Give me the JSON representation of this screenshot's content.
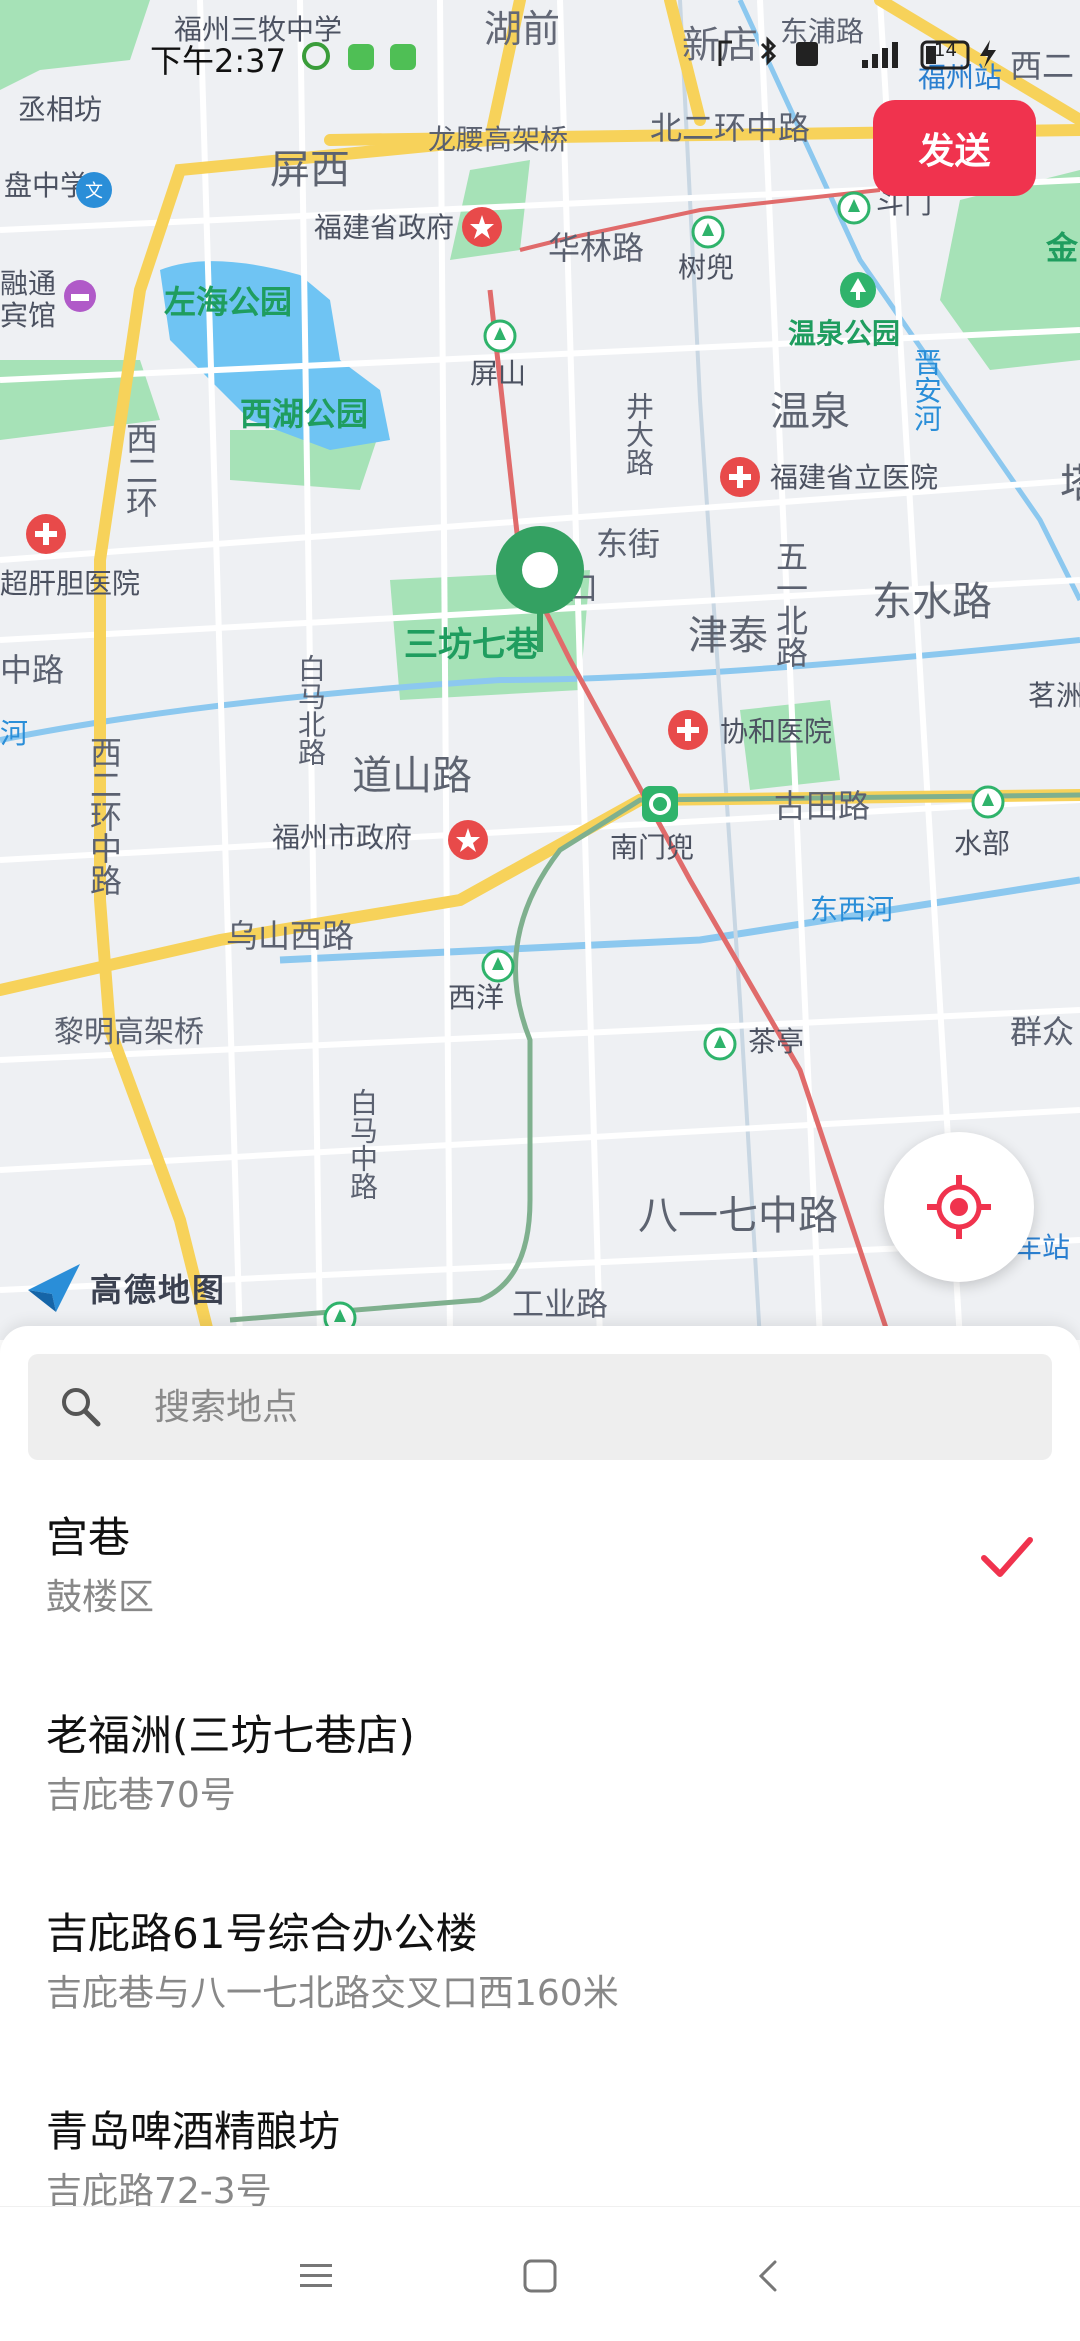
{
  "status_bar": {
    "time": "下午2:37",
    "battery": "14"
  },
  "toolbar": {
    "send_label": "发送"
  },
  "map": {
    "provider_logo_text": "高德地图",
    "pin_icon": "location-pin-icon",
    "locate_icon": "locate-target-icon",
    "labels": {
      "school": "福州三牧中学",
      "hupian": "湖前",
      "xindian": "新店",
      "dongpu_road": "东浦路",
      "fuzhou_station": "福州站",
      "xi_er": "西二",
      "chengxiangfang": "丞相坊",
      "pingxi": "屏西",
      "longteng": "龙腰高架桥",
      "beierhuan": "北二环中路",
      "doumen": "斗门",
      "jin": "金",
      "pan_school": "盘中学",
      "gov": "福建省政府",
      "hualin": "华林路",
      "shudou": "树兜",
      "rongtong": "融通",
      "hotel": "宾馆",
      "zuohai": "左海公园",
      "wenquan_park": "温泉公园",
      "pingshan": "屏山",
      "jinan_river": "晋安河",
      "wenquan": "温泉",
      "xihu": "西湖公园",
      "jingda": "井大路",
      "provincial_hosp": "福建省立医院",
      "ta": "塔",
      "xierhuan": "西二环",
      "liver_hosp": "超肝胆医院",
      "dongjie": "东街",
      "kou": "口",
      "wuyi": "五一北路",
      "dongshui": "东水路",
      "zhonglu": "中路",
      "sanfang": "三坊七巷",
      "jintai": "津泰",
      "mingzhu": "茗洲",
      "he": "河",
      "baima_n": "白马北路",
      "xiehe": "协和医院",
      "daoshan": "道山路",
      "xierhuan_z": "西二环中路",
      "city_gov": "福州市政府",
      "nanmen": "南门兜",
      "gutian": "古田路",
      "shuibu": "水部",
      "wushan": "乌山西路",
      "dongxi_river": "东西河",
      "xiyang": "西洋",
      "liming": "黎明高架桥",
      "chating": "茶亭",
      "qunzhong": "群众",
      "baima_z": "白马中路",
      "bayiqi": "八一七中路",
      "che_station": "车站",
      "gongye": "工业路"
    }
  },
  "search": {
    "placeholder": "搜索地点",
    "value": ""
  },
  "results": [
    {
      "name": "宫巷",
      "address": "鼓楼区",
      "selected": true
    },
    {
      "name": "老福洲(三坊七巷店)",
      "address": "吉庇巷70号",
      "selected": false
    },
    {
      "name": "吉庇路61号综合办公楼",
      "address": "吉庇巷与八一七北路交叉口西160米",
      "selected": false
    },
    {
      "name": "青岛啤酒精酿坊",
      "address": "吉庇路72-3号",
      "selected": false
    }
  ],
  "colors": {
    "accent": "#f0334e",
    "pin": "#34a162",
    "park": "#a6e2b7",
    "water": "#6fc4f3",
    "major_road": "#f7d25a",
    "metro_red": "#e06b6b",
    "metro_green": "#7fb08e"
  },
  "nav_bar": {
    "menu_icon": "menu-icon",
    "home_icon": "home-icon",
    "back_icon": "back-icon"
  }
}
